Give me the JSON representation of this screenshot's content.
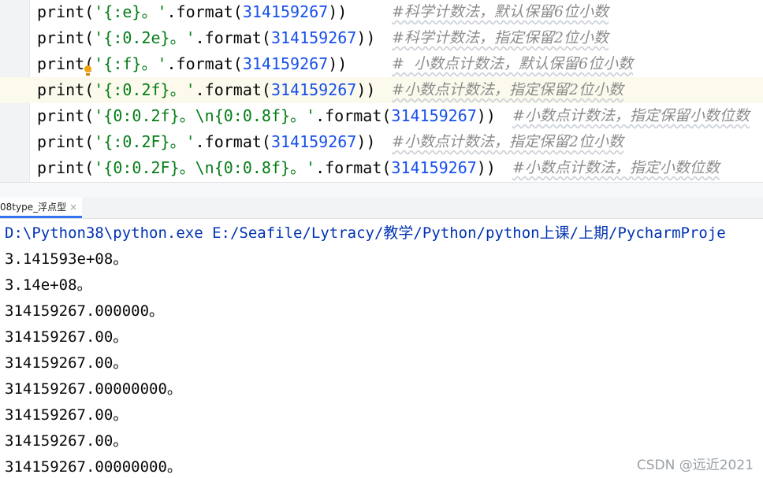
{
  "editor": {
    "lines": [
      {
        "pre": "print(",
        "str": "'{:e}。'",
        "mid": ".format(",
        "num": "314159267",
        "post": "))",
        "comment": "#科学计数法，默认保留6位小数"
      },
      {
        "pre": "print(",
        "str": "'{:0.2e}。'",
        "mid": ".format(",
        "num": "314159267",
        "post": "))",
        "comment": "#科学计数法，指定保留2位小数"
      },
      {
        "pre": "print(",
        "str": "'{:f}。'",
        "mid": ".format(",
        "num": "314159267",
        "post": "))",
        "comment": "#  小数点计数法，默认保留6位小数"
      },
      {
        "pre": "print(",
        "str": "'{:0.2f}。'",
        "mid": ".format(",
        "num": "314159267",
        "post": "))",
        "comment": "#小数点计数法，指定保留2位小数"
      },
      {
        "pre": "print(",
        "str": "'{0:0.2f}。\\n{0:0.8f}。'",
        "mid": ".format(",
        "num": "314159267",
        "post": "))",
        "comment": "#小数点计数法，指定保留小数位数"
      },
      {
        "pre": "print(",
        "str": "'{:0.2F}。'",
        "mid": ".format(",
        "num": "314159267",
        "post": "))",
        "comment": "#小数点计数法，指定保留2位小数"
      },
      {
        "pre": "print(",
        "str": "'{0:0.2F}。\\n{0:0.8f}。'",
        "mid": ".format(",
        "num": "314159267",
        "post": "))",
        "comment": "#小数点计数法，指定小数位数"
      }
    ]
  },
  "run_panel": {
    "tab_label": "08type_浮点型",
    "close_glyph": "×"
  },
  "console": {
    "command": "D:\\Python38\\python.exe E:/Seafile/Lytracy/教学/Python/python上课/上期/PycharmProje",
    "output": [
      "3.141593e+08。",
      "3.14e+08。",
      "314159267.000000。",
      "314159267.00。",
      "314159267.00。",
      "314159267.00000000。",
      "314159267.00。",
      "314159267.00。",
      "314159267.00000000。"
    ]
  },
  "watermark": "CSDN @远近2021",
  "colors": {
    "string": "#067d17",
    "number": "#1750eb",
    "comment": "#8c8c8c",
    "current_line": "#fcfaed",
    "tab_underline": "#3574f0"
  }
}
